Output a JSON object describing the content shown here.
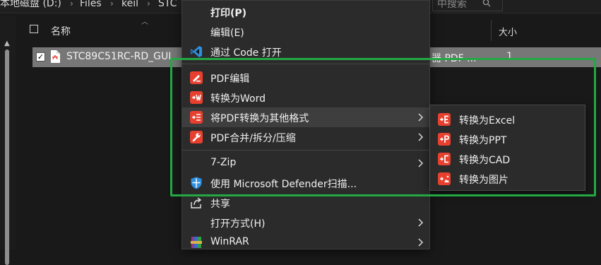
{
  "explorer": {
    "breadcrumbs": [
      "本地磁盘 (D:)",
      "Files",
      "keil",
      "STC"
    ],
    "search_placeholder": "中搜索",
    "columns": {
      "name": "名称",
      "size": "大小"
    },
    "file": {
      "name": "STC89C51RC-RD_GUI",
      "type": "器 PDF ...",
      "size": "1",
      "checked": true
    }
  },
  "context_menu": {
    "items": [
      {
        "label": "打印(P)",
        "bold": true,
        "icon": "none"
      },
      {
        "label": "编辑(E)",
        "bold": false,
        "icon": "none"
      },
      {
        "label": "通过 Code 打开",
        "bold": false,
        "icon": "vscode-icon"
      },
      {
        "label": "PDF编辑",
        "bold": false,
        "icon": "pdf-edit-icon"
      },
      {
        "label": "转换为Word",
        "bold": false,
        "icon": "pdf-to-word-icon"
      },
      {
        "label": "将PDF转换为其他格式",
        "bold": false,
        "icon": "pdf-convert-other-icon",
        "submenu": true
      },
      {
        "label": "PDF合并/拆分/压缩",
        "bold": false,
        "icon": "pdf-tools-icon",
        "submenu": true
      },
      {
        "label": "7-Zip",
        "bold": false,
        "icon": "none",
        "submenu": true
      },
      {
        "label": "使用 Microsoft Defender扫描...",
        "bold": false,
        "icon": "defender-shield-icon"
      },
      {
        "label": "共享",
        "bold": false,
        "icon": "share-icon"
      },
      {
        "label": "打开方式(H)",
        "bold": false,
        "icon": "none",
        "submenu": true
      },
      {
        "label": "WinRAR",
        "bold": false,
        "icon": "winrar-icon",
        "submenu": true
      }
    ]
  },
  "sub_menu": {
    "items": [
      {
        "label": "转换为Excel",
        "icon": "pdf-to-excel-icon"
      },
      {
        "label": "转换为PPT",
        "icon": "pdf-to-ppt-icon"
      },
      {
        "label": "转换为CAD",
        "icon": "pdf-to-cad-icon"
      },
      {
        "label": "转换为图片",
        "icon": "pdf-to-image-icon"
      }
    ]
  },
  "colors": {
    "menu_bg": "#2b2b2b",
    "pdf_red": "#e8402f",
    "highlight_green": "#23a843",
    "vscode_blue": "#2c8fe0",
    "selected_row": "#777777"
  }
}
